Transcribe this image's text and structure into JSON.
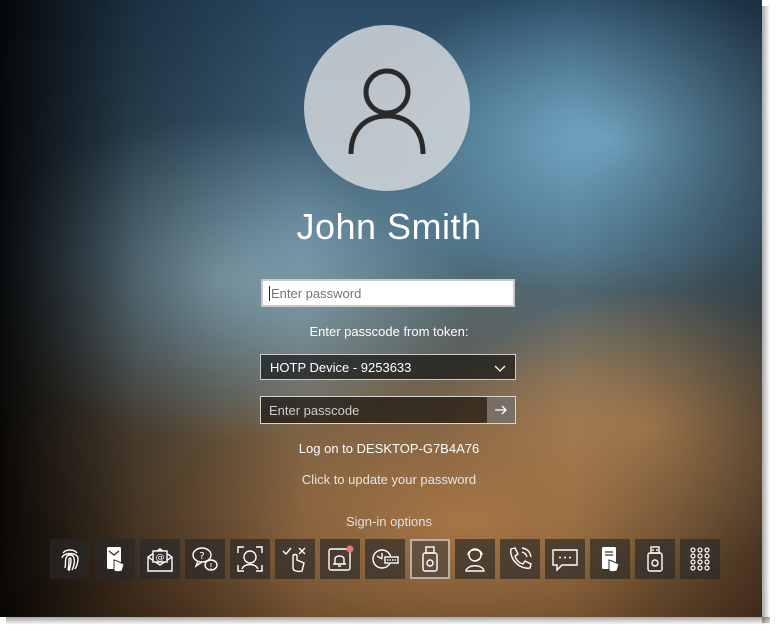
{
  "user": {
    "name": "John Smith",
    "avatar_icon": "user-silhouette-icon"
  },
  "password": {
    "placeholder": "Enter password",
    "value": ""
  },
  "token": {
    "label": "Enter passcode from token:",
    "selected_device": "HOTP Device - 9253633"
  },
  "passcode": {
    "placeholder": "Enter passcode",
    "value": ""
  },
  "logon_to": "Log on to DESKTOP-G7B4A76",
  "update_password_link": "Click to update your password",
  "signin_options": {
    "label": "Sign-in options",
    "selected_index": 8,
    "icons": [
      "fingerprint-icon",
      "mobile-push-icon",
      "email-otp-icon",
      "security-questions-icon",
      "face-recognition-icon",
      "touch-approve-deny-icon",
      "push-notification-icon",
      "hardware-token-icon",
      "usb-token-icon",
      "help-desk-icon",
      "voice-call-icon",
      "sms-icon",
      "mobile-otp-icon",
      "usb-key-icon",
      "pin-keypad-icon"
    ]
  }
}
